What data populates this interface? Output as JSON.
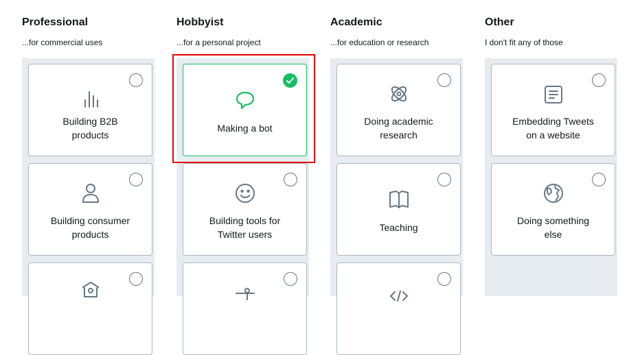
{
  "columns": [
    {
      "title": "Professional",
      "subtitle": "...for commercial uses",
      "cards": [
        {
          "label_line1": "Building B2B",
          "label_line2": "products",
          "icon": "bar-chart-icon",
          "selected": false
        },
        {
          "label_line1": "Building consumer",
          "label_line2": "products",
          "icon": "person-icon",
          "selected": false
        },
        {
          "label_line1": "",
          "label_line2": "",
          "icon": "birdhouse-icon",
          "selected": false
        }
      ]
    },
    {
      "title": "Hobbyist",
      "subtitle": "...for a personal project",
      "cards": [
        {
          "label_line1": "Making a bot",
          "label_line2": "",
          "icon": "speech-bubble-icon",
          "selected": true
        },
        {
          "label_line1": "Building tools for",
          "label_line2": "Twitter users",
          "icon": "smiley-icon",
          "selected": false
        },
        {
          "label_line1": "",
          "label_line2": "",
          "icon": "tools-icon",
          "selected": false
        }
      ]
    },
    {
      "title": "Academic",
      "subtitle": "...for education or research",
      "cards": [
        {
          "label_line1": "Doing academic",
          "label_line2": "research",
          "icon": "atom-icon",
          "selected": false
        },
        {
          "label_line1": "Teaching",
          "label_line2": "",
          "icon": "book-icon",
          "selected": false
        },
        {
          "label_line1": "",
          "label_line2": "",
          "icon": "code-icon",
          "selected": false
        }
      ]
    },
    {
      "title": "Other",
      "subtitle": "I don't fit any of those",
      "cards": [
        {
          "label_line1": "Embedding Tweets",
          "label_line2": "on a website",
          "icon": "document-icon",
          "selected": false
        },
        {
          "label_line1": "Doing something",
          "label_line2": "else",
          "icon": "globe-icon",
          "selected": false
        }
      ]
    }
  ],
  "colors": {
    "accent_green": "#17bf63",
    "panel_bg": "#e6ecf0",
    "card_border": "#aab8c2",
    "icon_gray": "#657786",
    "highlight_red": "#e0000a"
  }
}
